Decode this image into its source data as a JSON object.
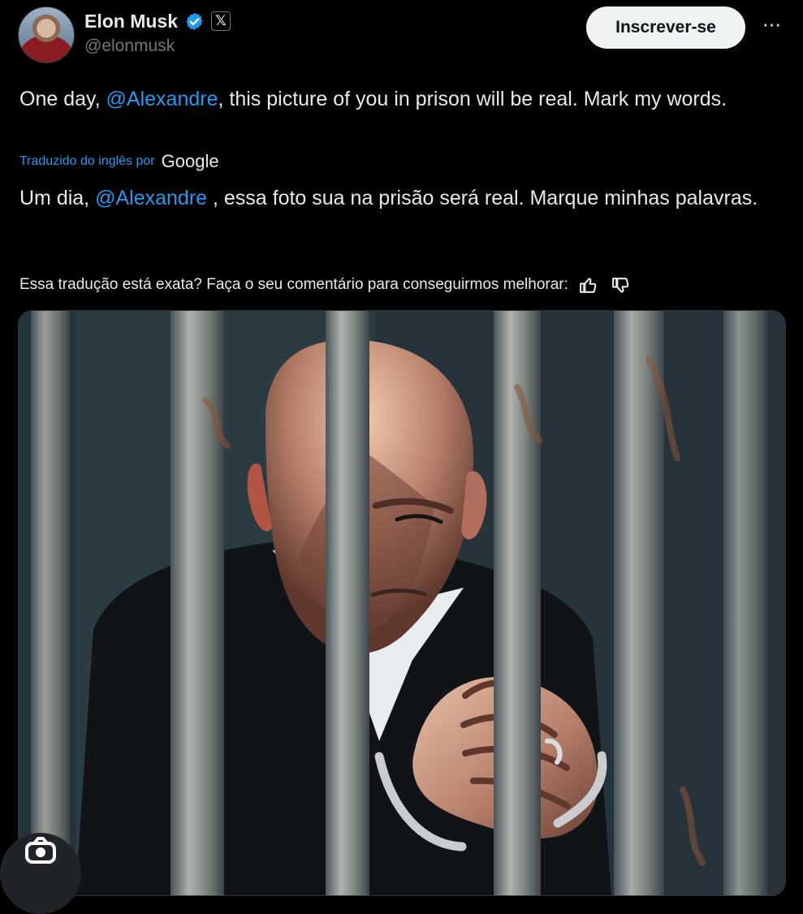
{
  "author": {
    "name": "Elon Musk",
    "handle": "@elonmusk",
    "verified_icon": "verified-badge-icon",
    "badge_icon": "x-logo-icon",
    "badge_text": "𝕏"
  },
  "actions": {
    "subscribe_label": "Inscrever-se",
    "more_icon": "more-horizontal-icon",
    "more_text": "···"
  },
  "tweet": {
    "original": {
      "prefix": "One day, ",
      "mention": "@Alexandre",
      "suffix": ", this picture of you in prison will be real. Mark my words."
    },
    "translation_label": "Traduzido do inglês por",
    "translation_provider": "Google",
    "translated": {
      "prefix": "Um dia, ",
      "mention": "@Alexandre",
      "suffix": " , essa foto sua na prisão será real. Marque minhas palavras."
    },
    "feedback_prompt": "Essa tradução está exata? Faça o seu comentário para conseguirmos melhorar:",
    "feedback_icons": [
      "thumbs-up-icon",
      "thumbs-down-icon"
    ]
  },
  "media": {
    "type": "image",
    "icons": [
      "lens-icon"
    ]
  },
  "colors": {
    "background": "#000000",
    "text": "#e7e9ea",
    "muted": "#71767b",
    "link": "#1d9bf0",
    "button": "#eff3f4"
  }
}
